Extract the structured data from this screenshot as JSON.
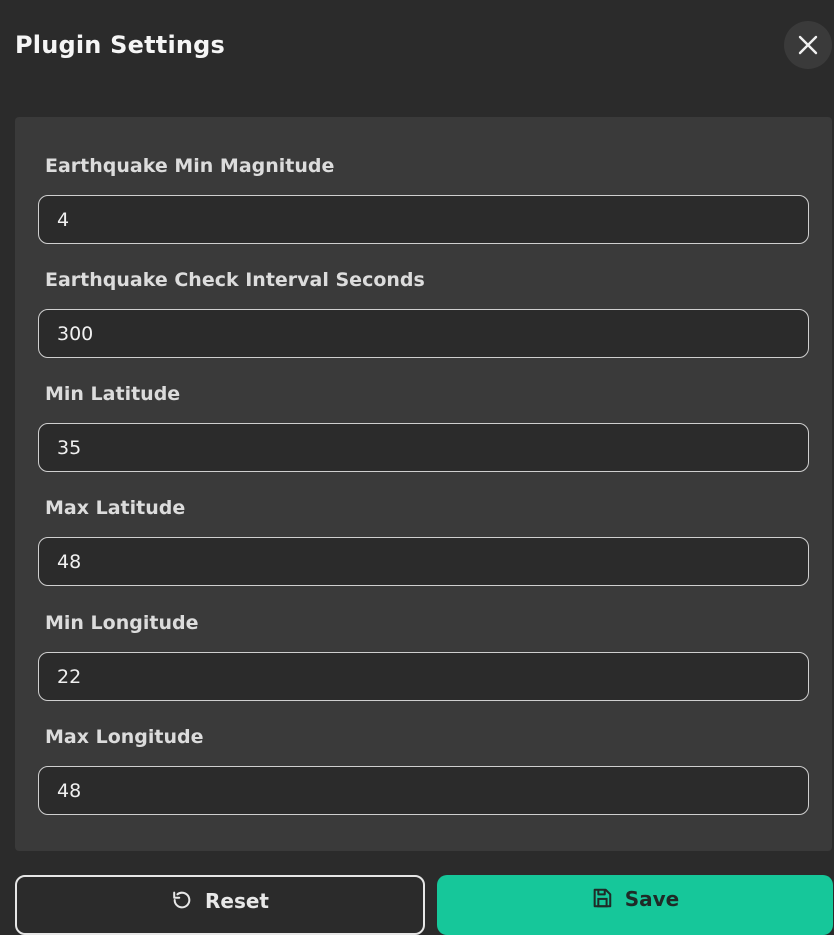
{
  "dialog": {
    "title": "Plugin Settings",
    "close_icon": "close-icon"
  },
  "fields": [
    {
      "label": "Earthquake Min Magnitude",
      "value": "4"
    },
    {
      "label": "Earthquake Check Interval Seconds",
      "value": "300"
    },
    {
      "label": "Min Latitude",
      "value": "35"
    },
    {
      "label": "Max Latitude",
      "value": "48"
    },
    {
      "label": "Min Longitude",
      "value": "22"
    },
    {
      "label": "Max Longitude",
      "value": "48"
    }
  ],
  "actions": {
    "reset_label": "Reset",
    "reset_icon": "reset-icon",
    "save_label": "Save",
    "save_icon": "save-icon"
  },
  "colors": {
    "background": "#2b2b2b",
    "panel": "#3a3a3a",
    "accent": "#16c79a"
  }
}
